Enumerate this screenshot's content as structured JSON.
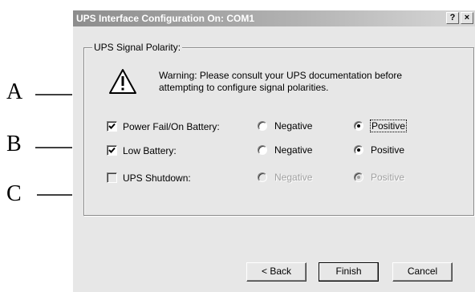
{
  "annotations": {
    "labels": [
      "A",
      "B",
      "C"
    ]
  },
  "dialog": {
    "title": "UPS Interface Configuration On: COM1",
    "help_label": "?",
    "close_label": "×",
    "group_title": "UPS Signal Polarity:",
    "warning_text": "Warning: Please consult your UPS documentation before attempting to configure signal polarities.",
    "signals": [
      {
        "label": "Power Fail/On Battery:",
        "checked": true,
        "polarity": "Positive",
        "enabled": true
      },
      {
        "label": "Low Battery:",
        "checked": true,
        "polarity": "Positive",
        "enabled": true
      },
      {
        "label": "UPS Shutdown:",
        "checked": false,
        "polarity": "Positive",
        "enabled": false
      }
    ],
    "negative_label": "Negative",
    "positive_label": "Positive",
    "buttons": {
      "back": "< Back",
      "finish": "Finish",
      "cancel": "Cancel"
    }
  }
}
